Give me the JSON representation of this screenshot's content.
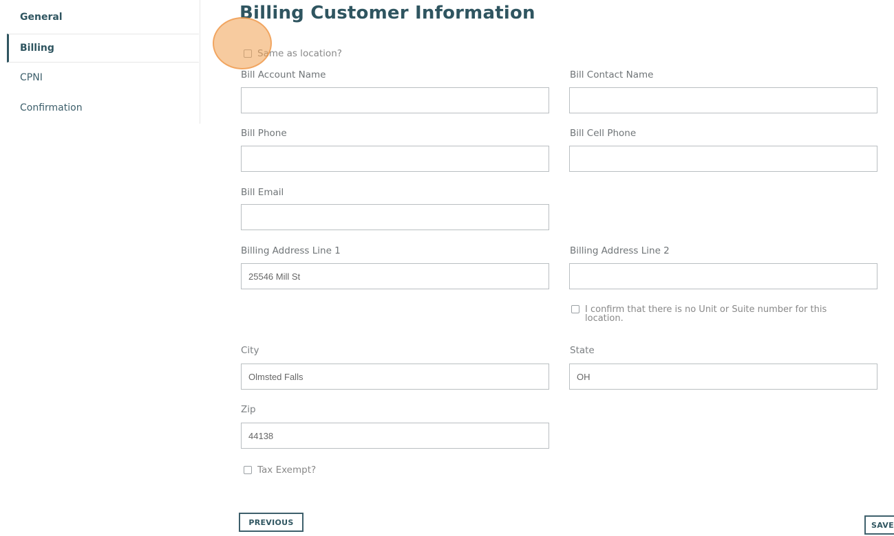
{
  "sidebar": {
    "items": [
      {
        "label": "General"
      },
      {
        "label": "Billing"
      },
      {
        "label": "CPNI"
      },
      {
        "label": "Confirmation"
      }
    ]
  },
  "page_title": "Billing Customer Information",
  "same_as_location_label": "Same as location?",
  "fields": {
    "bill_account_name": {
      "label": "Bill Account Name",
      "value": ""
    },
    "bill_contact_name": {
      "label": "Bill Contact Name",
      "value": ""
    },
    "bill_phone": {
      "label": "Bill Phone",
      "value": ""
    },
    "bill_cell_phone": {
      "label": "Bill Cell Phone",
      "value": ""
    },
    "bill_email": {
      "label": "Bill Email",
      "value": ""
    },
    "billing_address_line1": {
      "label": "Billing Address Line 1",
      "value": "25546 Mill St"
    },
    "billing_address_line2": {
      "label": "Billing Address Line 2",
      "value": ""
    },
    "city": {
      "label": "City",
      "value": "Olmsted Falls"
    },
    "state": {
      "label": "State",
      "value": "OH"
    },
    "zip": {
      "label": "Zip",
      "value": "44138"
    }
  },
  "no_unit_confirm_label": "I confirm that there is no Unit or Suite number for this location.",
  "tax_exempt_label": "Tax Exempt?",
  "buttons": {
    "previous": "PREVIOUS",
    "save": "SAVE"
  },
  "colors": {
    "accent": "#2f5560",
    "click_indicator": "#f0a050"
  }
}
